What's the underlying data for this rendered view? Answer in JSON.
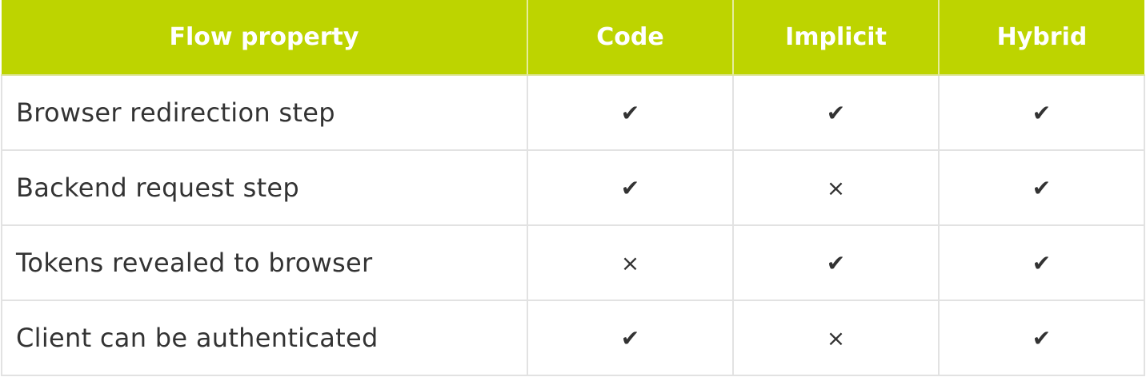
{
  "table": {
    "headers": [
      "Flow property",
      "Code",
      "Implicit",
      "Hybrid"
    ],
    "rows": [
      {
        "label": "Browser redirection step",
        "code": "✔",
        "implicit": "✔",
        "hybrid": "✔"
      },
      {
        "label": "Backend request step",
        "code": "✔",
        "implicit": "×",
        "hybrid": "✔"
      },
      {
        "label": "Tokens revealed to browser",
        "code": "×",
        "implicit": "✔",
        "hybrid": "✔"
      },
      {
        "label": "Client can be authenticated",
        "code": "✔",
        "implicit": "×",
        "hybrid": "✔"
      }
    ]
  },
  "colors": {
    "header_bg": "#bdd400",
    "header_text": "#ffffff",
    "body_text": "#333333",
    "border": "#e2e2e2"
  }
}
